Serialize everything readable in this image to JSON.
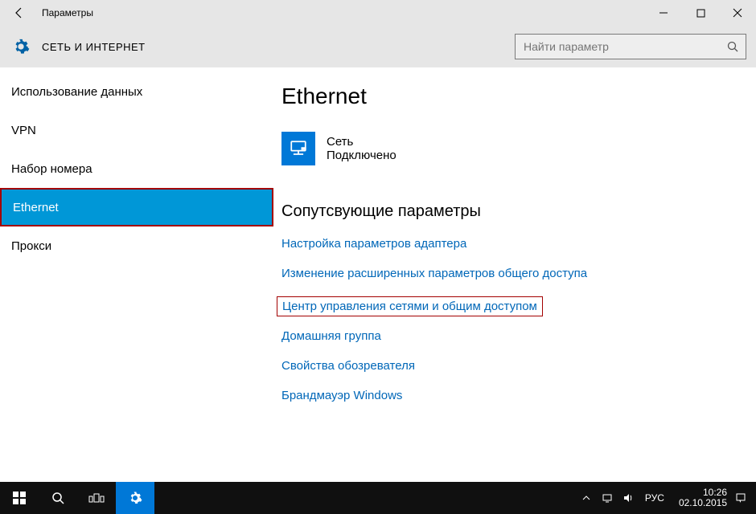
{
  "titlebar": {
    "title": "Параметры"
  },
  "header": {
    "section": "СЕТЬ И ИНТЕРНЕТ",
    "search_placeholder": "Найти параметр"
  },
  "sidebar": {
    "items": [
      {
        "label": "Использование данных",
        "active": false
      },
      {
        "label": "VPN",
        "active": false
      },
      {
        "label": "Набор номера",
        "active": false
      },
      {
        "label": "Ethernet",
        "active": true
      },
      {
        "label": "Прокси",
        "active": false
      }
    ]
  },
  "content": {
    "page_title": "Ethernet",
    "network": {
      "name": "Сеть",
      "status": "Подключено"
    },
    "related_heading": "Сопутсвующие параметры",
    "links": [
      "Настройка параметров адаптера",
      "Изменение расширенных параметров общего доступа",
      "Центр управления сетями и общим доступом",
      "Домашняя группа",
      "Свойства обозревателя",
      "Брандмауэр Windows"
    ],
    "highlighted_link_index": 2
  },
  "taskbar": {
    "lang": "РУС",
    "time": "10:26",
    "date": "02.10.2015"
  }
}
